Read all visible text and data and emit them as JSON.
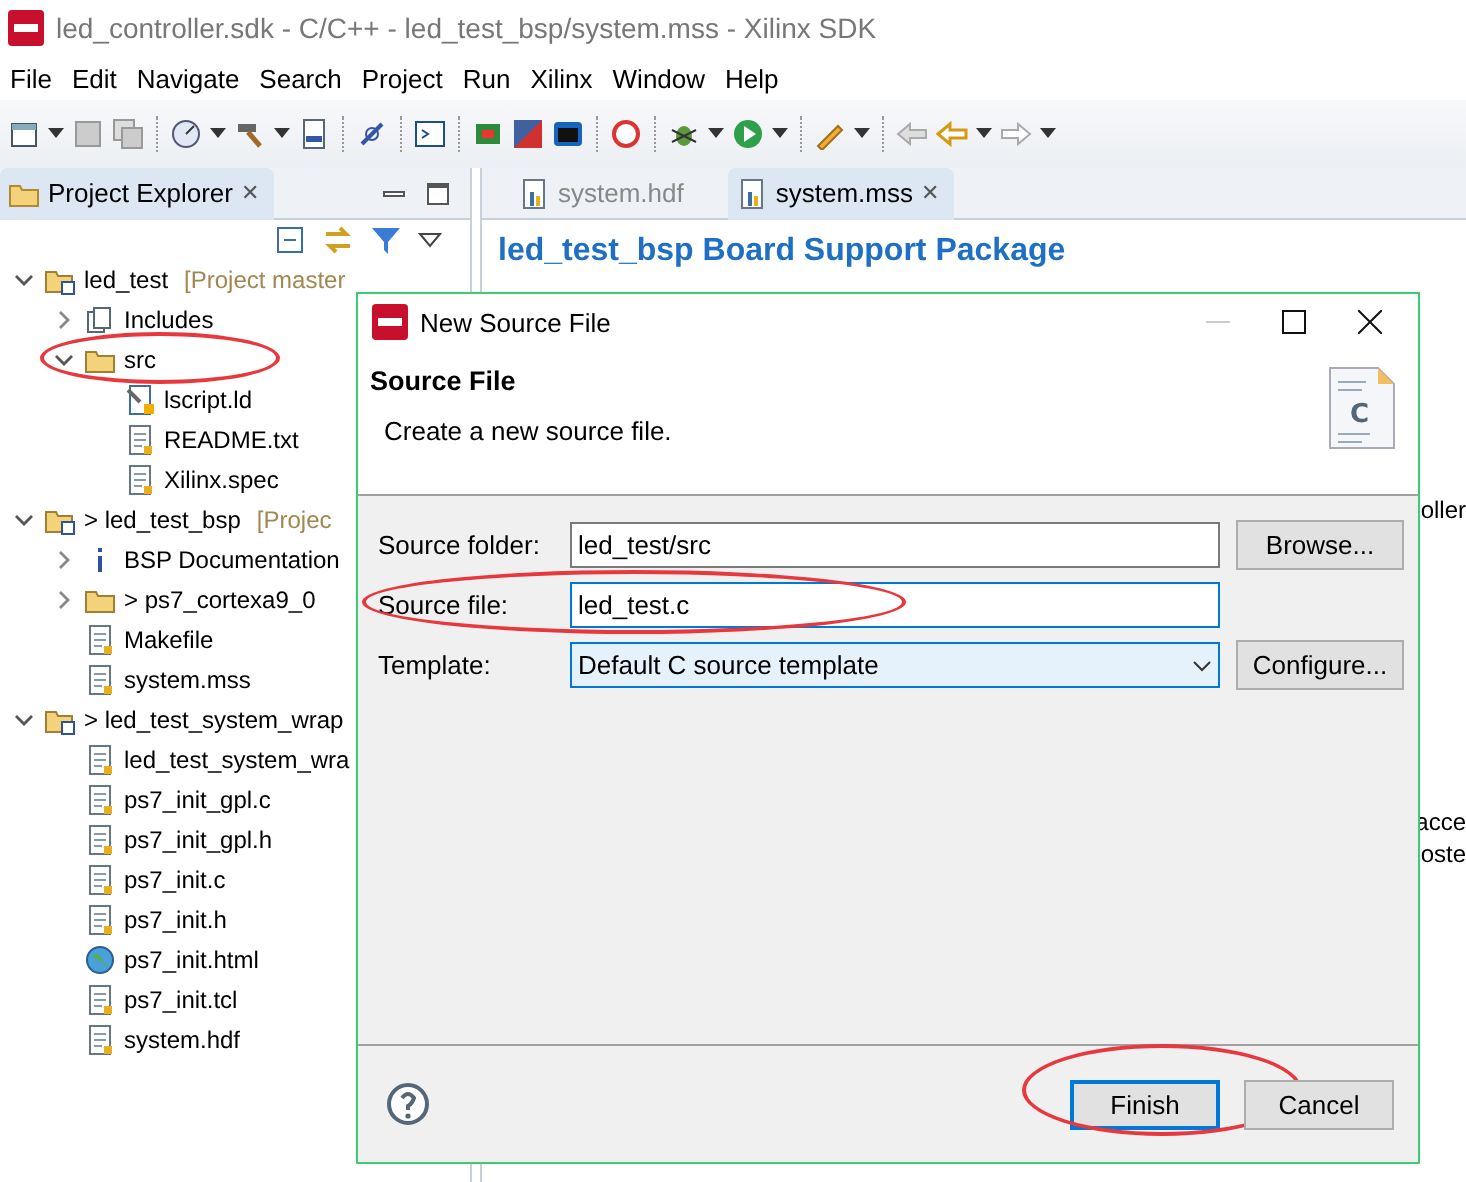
{
  "window": {
    "title": "led_controller.sdk - C/C++ - led_test_bsp/system.mss - Xilinx SDK"
  },
  "menu": [
    "File",
    "Edit",
    "Navigate",
    "Search",
    "Project",
    "Run",
    "Xilinx",
    "Window",
    "Help"
  ],
  "explorer": {
    "title": "Project Explorer",
    "close": "✕",
    "tree": [
      {
        "label": "led_test",
        "note": "[Project master",
        "kind": "project",
        "expanded": true,
        "children": [
          {
            "label": "Includes",
            "kind": "lib",
            "expanded": false,
            "circled": false
          },
          {
            "label": "src",
            "kind": "folder",
            "expanded": true,
            "circled": true,
            "children": [
              {
                "label": "lscript.ld",
                "kind": "script"
              },
              {
                "label": "README.txt",
                "kind": "file"
              },
              {
                "label": "Xilinx.spec",
                "kind": "file"
              }
            ]
          }
        ]
      },
      {
        "label": "> led_test_bsp",
        "note": "[Projec",
        "kind": "project",
        "expanded": true,
        "children": [
          {
            "label": "BSP Documentation",
            "kind": "info",
            "expanded": false
          },
          {
            "label": "> ps7_cortexa9_0",
            "kind": "folder",
            "expanded": false
          },
          {
            "label": "Makefile",
            "kind": "file"
          },
          {
            "label": "system.mss",
            "kind": "file"
          }
        ]
      },
      {
        "label": "> led_test_system_wrap",
        "kind": "project",
        "expanded": true,
        "children": [
          {
            "label": "led_test_system_wra",
            "kind": "file"
          },
          {
            "label": "ps7_init_gpl.c",
            "kind": "file"
          },
          {
            "label": "ps7_init_gpl.h",
            "kind": "file"
          },
          {
            "label": "ps7_init.c",
            "kind": "file"
          },
          {
            "label": "ps7_init.h",
            "kind": "file"
          },
          {
            "label": "ps7_init.html",
            "kind": "web"
          },
          {
            "label": "ps7_init.tcl",
            "kind": "file"
          },
          {
            "label": "system.hdf",
            "kind": "file"
          }
        ]
      }
    ]
  },
  "editor": {
    "tabs": [
      {
        "label": "system.hdf",
        "selected": false
      },
      {
        "label": "system.mss",
        "selected": true,
        "close": "✕"
      }
    ],
    "heading": "led_test_bsp Board Support Package",
    "fragments": [
      "oller",
      "acce",
      "oste"
    ]
  },
  "dialog": {
    "title": "New Source File",
    "header": "Source File",
    "description": "Create a new source file.",
    "icon_letter": "C",
    "fields": [
      {
        "label": "Source folder:",
        "value": "led_test/src",
        "kind": "text",
        "focused": false,
        "circled": false,
        "button": "Browse..."
      },
      {
        "label": "Source file:",
        "value": "led_test.c",
        "kind": "text",
        "focused": true,
        "circled": true
      },
      {
        "label": "Template:",
        "value": "Default C source template",
        "kind": "select",
        "circled": false,
        "button": "Configure..."
      }
    ],
    "buttons": [
      {
        "label": "Finish",
        "default": true,
        "circled": true
      },
      {
        "label": "Cancel",
        "default": false,
        "circled": false
      }
    ]
  }
}
